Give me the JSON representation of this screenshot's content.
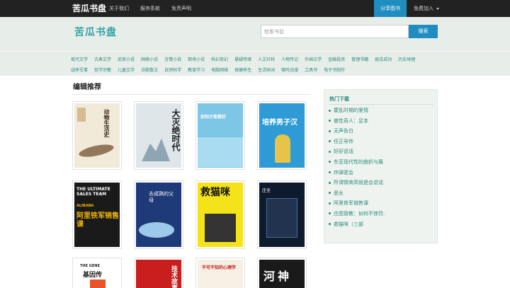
{
  "topbar": {
    "brand": "苦瓜书盘",
    "links": [
      "关于我们",
      "服务条款",
      "免责声明"
    ],
    "share": "分享图书",
    "join": "免费加入"
  },
  "header": {
    "logo": "苦瓜书盘",
    "search_placeholder": "检索书目",
    "search_button": "搜索"
  },
  "categories": [
    "现代文学",
    "古典文学",
    "武侠小说",
    "网络小说",
    "言情小说",
    "职场小说",
    "科幻奇幻",
    "悬疑惊悚",
    "人文社科",
    "人物传记",
    "外国文学",
    "金融投资",
    "管理书籍",
    "励志成功",
    "历史地理",
    "战争军事",
    "哲学宗教",
    "儿童文学",
    "诗歌散文",
    "自然科学",
    "教育学习",
    "电脑网络",
    "保健养生",
    "生活休闲",
    "哪吒动漫",
    "工具书",
    "电子书制作"
  ],
  "main": {
    "title": "编辑推荐"
  },
  "covers": {
    "b1": "动物生活史",
    "b2": "大灭绝时代",
    "b3": "如何才能做好",
    "b4": "培养男子汉",
    "b5_en": "THE ULTIMATE SALES TEAM",
    "b5_cn": "阿里铁军销售课",
    "b5_logo": "ALIBABA",
    "b6": "去成熟的父母",
    "b7": "救猫咪",
    "b8": "庄全",
    "b9_en": "THE GENE",
    "b9_cn": "基因传",
    "b10": "技术故事",
    "b11": "不可不知的心理学",
    "b12": "河神"
  },
  "sidebar": {
    "title": "热门下载",
    "items": [
      "霍乱时期的爱情",
      "做性奇人：足本",
      "无声告白",
      "任正非传",
      "好好说话",
      "东亚现代性的曲折与展",
      "炸弹密会",
      "所谓情商高就是会说话",
      "恶女",
      "阿里铁军销售课",
      "庄图冒教：如何不惊罚.",
      "救猫咪（三部"
    ]
  },
  "colors": {
    "accent": "#1f8dc0",
    "green": "#2a8b7c",
    "topbar": "#222222",
    "header_bg": "#e7ede9"
  }
}
